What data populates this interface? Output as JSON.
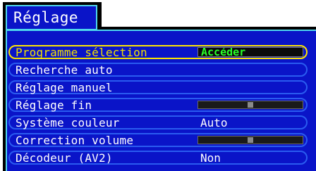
{
  "menu": {
    "title": "Réglage",
    "items": [
      {
        "label": "Programme sélection",
        "control": "action",
        "value": "Accéder",
        "selected": true
      },
      {
        "label": "Recherche auto",
        "control": "none"
      },
      {
        "label": "Réglage manuel",
        "control": "none"
      },
      {
        "label": "Réglage fin",
        "control": "slider",
        "level": 0.5
      },
      {
        "label": "Système couleur",
        "control": "text",
        "value": "Auto"
      },
      {
        "label": "Correction volume",
        "control": "slider",
        "level": 0.5
      },
      {
        "label": "Décodeur (AV2)",
        "control": "text",
        "value": "Non"
      }
    ]
  },
  "colors": {
    "panel_background": "#0a14c8",
    "panel_border": "#4fd6ec",
    "row_outline": "#2a5cf0",
    "selected_outline": "#ffe600",
    "selected_text": "#f2e000",
    "action_text": "#28ff28"
  }
}
